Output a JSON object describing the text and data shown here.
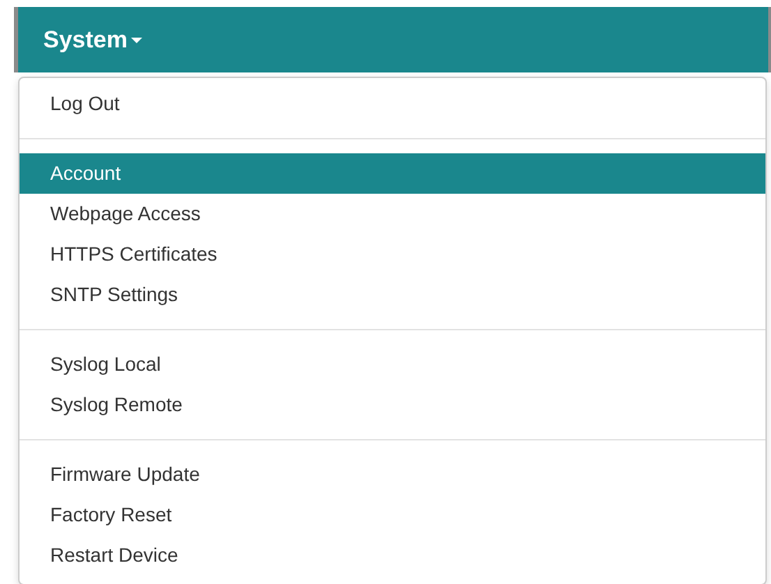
{
  "navbar": {
    "menu_title": "System"
  },
  "dropdown": {
    "groups": [
      {
        "items": [
          {
            "label": "Log Out",
            "selected": false
          }
        ]
      },
      {
        "items": [
          {
            "label": "Account",
            "selected": true
          },
          {
            "label": "Webpage Access",
            "selected": false
          },
          {
            "label": "HTTPS Certificates",
            "selected": false
          },
          {
            "label": "SNTP Settings",
            "selected": false
          }
        ]
      },
      {
        "items": [
          {
            "label": "Syslog Local",
            "selected": false
          },
          {
            "label": "Syslog Remote",
            "selected": false
          }
        ]
      },
      {
        "items": [
          {
            "label": "Firmware Update",
            "selected": false
          },
          {
            "label": "Factory Reset",
            "selected": false
          },
          {
            "label": "Restart Device",
            "selected": false
          }
        ]
      }
    ]
  }
}
